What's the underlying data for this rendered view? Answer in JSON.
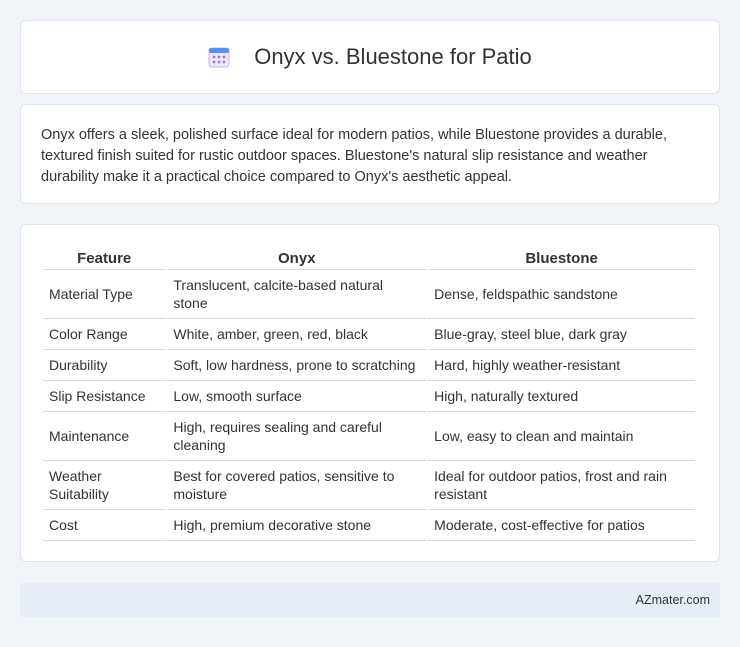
{
  "header": {
    "title": "Onyx vs. Bluestone for Patio",
    "icon": "calendar-icon",
    "icon_colors": {
      "top": "#5b8def",
      "grid": "#c9b6e4",
      "dots": "#9b7fd1"
    }
  },
  "summary": {
    "text": "Onyx offers a sleek, polished surface ideal for modern patios, while Bluestone provides a durable, textured finish suited for rustic outdoor spaces. Bluestone's natural slip resistance and weather durability make it a practical choice compared to Onyx's aesthetic appeal."
  },
  "table": {
    "headers": [
      "Feature",
      "Onyx",
      "Bluestone"
    ],
    "rows": [
      [
        "Material Type",
        "Translucent, calcite-based natural stone",
        "Dense, feldspathic sandstone"
      ],
      [
        "Color Range",
        "White, amber, green, red, black",
        "Blue-gray, steel blue, dark gray"
      ],
      [
        "Durability",
        "Soft, low hardness, prone to scratching",
        "Hard, highly weather-resistant"
      ],
      [
        "Slip Resistance",
        "Low, smooth surface",
        "High, naturally textured"
      ],
      [
        "Maintenance",
        "High, requires sealing and careful cleaning",
        "Low, easy to clean and maintain"
      ],
      [
        "Weather Suitability",
        "Best for covered patios, sensitive to moisture",
        "Ideal for outdoor patios, frost and rain resistant"
      ],
      [
        "Cost",
        "High, premium decorative stone",
        "Moderate, cost-effective for patios"
      ]
    ]
  },
  "footer": {
    "source": "AZmater.com"
  }
}
